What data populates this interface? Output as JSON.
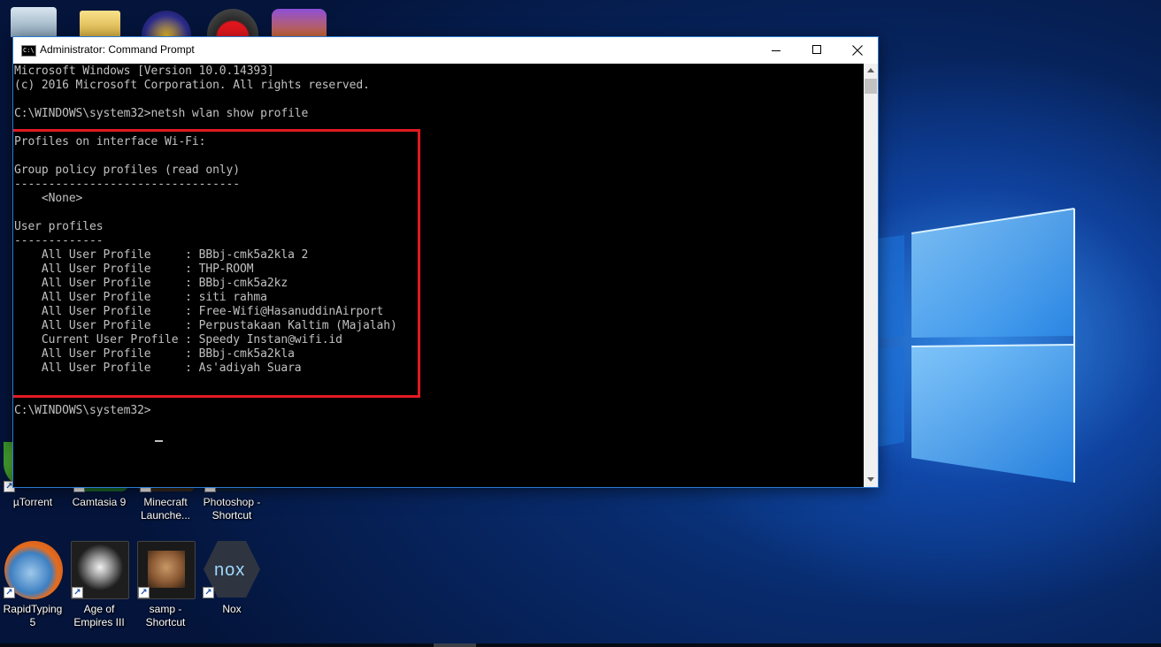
{
  "window": {
    "title": "Administrator: Command Prompt",
    "icon_label": "C:\\"
  },
  "console": {
    "lines": [
      "Microsoft Windows [Version 10.0.14393]",
      "(c) 2016 Microsoft Corporation. All rights reserved.",
      "",
      "C:\\WINDOWS\\system32>netsh wlan show profile",
      "",
      "Profiles on interface Wi-Fi:",
      "",
      "Group policy profiles (read only)",
      "---------------------------------",
      "    <None>",
      "",
      "User profiles",
      "-------------",
      "    All User Profile     : BBbj-cmk5a2kla 2",
      "    All User Profile     : THP-ROOM",
      "    All User Profile     : BBbj-cmk5a2kz",
      "    All User Profile     : siti rahma",
      "    All User Profile     : Free-Wifi@HasanuddinAirport",
      "    All User Profile     : Perpustakaan Kaltim (Majalah)",
      "    Current User Profile : Speedy Instan@wifi.id",
      "    All User Profile     : BBbj-cmk5a2kla",
      "    All User Profile     : As'adiyah Suara",
      "",
      "C:\\WINDOWS\\system32>"
    ]
  },
  "desktop_icons": [
    {
      "label": "µTorrent",
      "icon": "utorrent-icon"
    },
    {
      "label": "Camtasia 9",
      "icon": "camtasia-icon"
    },
    {
      "label": "Minecraft Launche...",
      "icon": "minecraft-icon"
    },
    {
      "label": "Photoshop - Shortcut",
      "icon": "photoshop-icon"
    },
    {
      "label": "RapidTyping 5",
      "icon": "rapidtyping-icon"
    },
    {
      "label": "Age of Empires III",
      "icon": "age-of-empires-icon"
    },
    {
      "label": "samp - Shortcut",
      "icon": "samp-icon"
    },
    {
      "label": "Nox",
      "icon": "nox-icon"
    }
  ],
  "colors": {
    "highlight": "#e21a22",
    "console_bg": "#000000",
    "console_text": "#c0c0c0",
    "window_border": "#2b79d0"
  }
}
